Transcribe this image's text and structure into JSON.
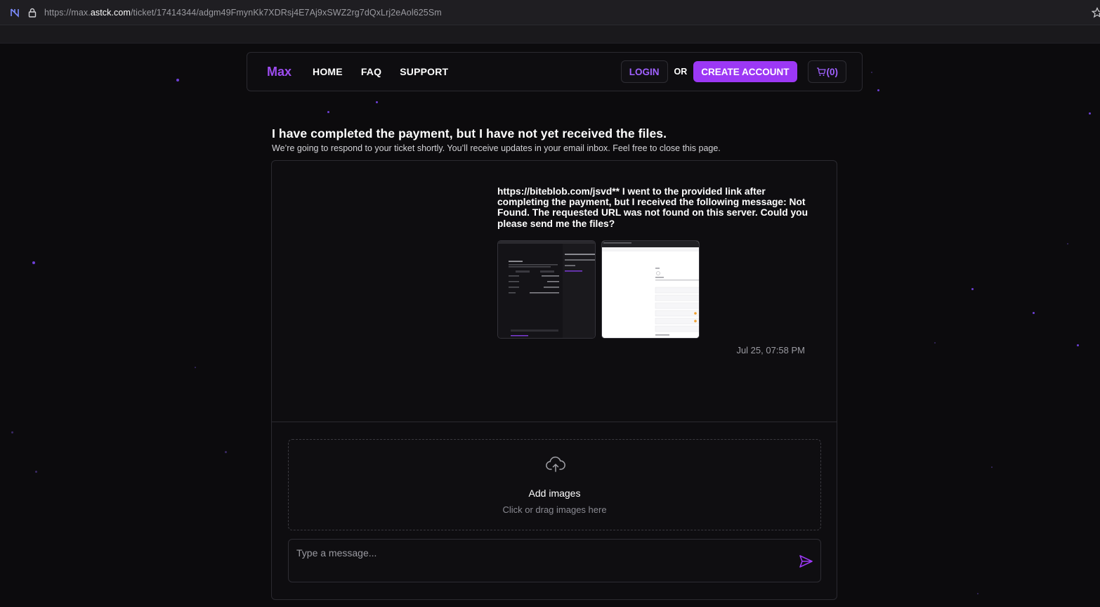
{
  "browser": {
    "url_prefix": "https://max.",
    "url_domain": "astck.com",
    "url_path": "/ticket/17414344/adgm49FmynKk7XDRsj4E7Aj9xSWZ2rg7dQxLrj2eAol625Sm"
  },
  "nav": {
    "logo": "Max",
    "links": [
      "HOME",
      "FAQ",
      "SUPPORT"
    ],
    "login": "LOGIN",
    "or": "OR",
    "create_account": "CREATE ACCOUNT",
    "cart": "(0)"
  },
  "ticket": {
    "title": "I have completed the payment, but I have not yet received the files.",
    "subtitle": "We’re going to respond to your ticket shortly. You’ll receive updates in your email inbox. Feel free to close this page.",
    "message": "https://biteblob.com/jsvd** I went to the provided link after completing the payment, but I received the following message: Not Found. The requested URL was not found on this server. Could you please send me the files?",
    "timestamp": "Jul 25, 07:58 PM"
  },
  "upload": {
    "title": "Add images",
    "subtitle": "Click or drag images here"
  },
  "composer": {
    "placeholder": "Type a message..."
  },
  "colors": {
    "accent": "#9c38f5",
    "accent_text": "#a061ff",
    "background": "#0c0b0d"
  }
}
